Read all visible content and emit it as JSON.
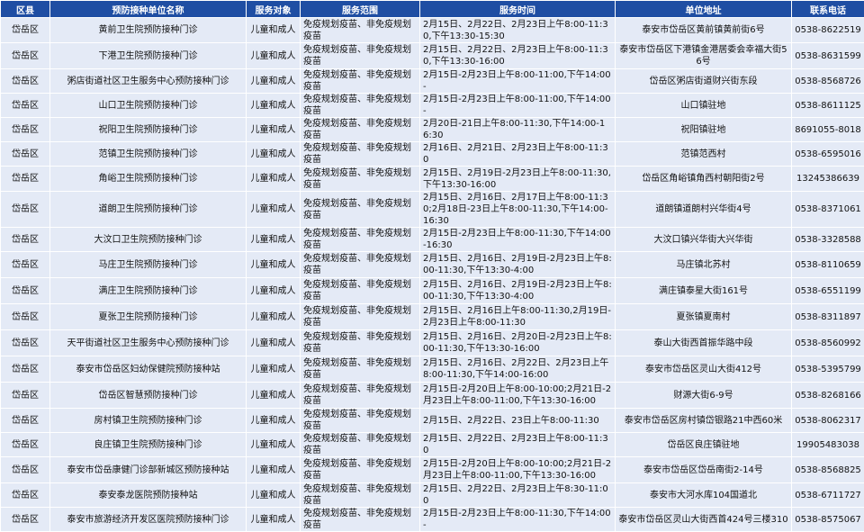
{
  "header": [
    "区县",
    "预防接种单位名称",
    "服务对象",
    "服务范围",
    "服务时间",
    "单位地址",
    "联系电话"
  ],
  "rows": [
    {
      "county": "岱岳区",
      "name": "黄前卫生院预防接种门诊",
      "target": "儿童和成人",
      "scope": "免疫规划疫苗、非免疫规划疫苗",
      "time": "2月15日、2月22日、2月23日上午8:00-11:30,下午13:30-15:30",
      "address": "泰安市岱岳区黄前镇黄前街6号",
      "phone": "0538-8622519"
    },
    {
      "county": "岱岳区",
      "name": "下港卫生院预防接种门诊",
      "target": "儿童和成人",
      "scope": "免疫规划疫苗、非免疫规划疫苗",
      "time": "2月15日、2月22日、2月23日上午8:00-11:30,下午13:30-16:00",
      "address": "泰安市岱岳区下港镇金港居委会幸福大街56号",
      "phone": "0538-8631599"
    },
    {
      "county": "岱岳区",
      "name": "粥店街道社区卫生服务中心预防接种门诊",
      "target": "儿童和成人",
      "scope": "免疫规划疫苗、非免疫规划疫苗",
      "time": "2月15日-2月23日上午8:00-11:00,下午14:00-",
      "address": "岱岳区粥店街道财兴街东段",
      "phone": "0538-8568726"
    },
    {
      "county": "岱岳区",
      "name": "山口卫生院预防接种门诊",
      "target": "儿童和成人",
      "scope": "免疫规划疫苗、非免疫规划疫苗",
      "time": "2月15日-2月23日上午8:00-11:00,下午14:00-",
      "address": "山口镇驻地",
      "phone": "0538-8611125"
    },
    {
      "county": "岱岳区",
      "name": "祝阳卫生院预防接种门诊",
      "target": "儿童和成人",
      "scope": "免疫规划疫苗、非免疫规划疫苗",
      "time": "2月20日-21日上午8:00-11:30,下午14:00-16:30",
      "address": "祝阳镇驻地",
      "phone": "8691055-8018"
    },
    {
      "county": "岱岳区",
      "name": "范镇卫生院预防接种门诊",
      "target": "儿童和成人",
      "scope": "免疫规划疫苗、非免疫规划疫苗",
      "time": "2月16日、2月21日、2月23日上午8:00-11:30",
      "address": "范镇范西村",
      "phone": "0538-6595016"
    },
    {
      "county": "岱岳区",
      "name": "角峪卫生院预防接种门诊",
      "target": "儿童和成人",
      "scope": "免疫规划疫苗、非免疫规划疫苗",
      "time": "2月15日、2月19日-2月23日上午8:00-11:30,下午13:30-16:00",
      "address": "岱岳区角峪镇角西村朝阳街2号",
      "phone": "13245386639"
    },
    {
      "county": "岱岳区",
      "name": "道朗卫生院预防接种门诊",
      "target": "儿童和成人",
      "scope": "免疫规划疫苗、非免疫规划疫苗",
      "time": "2月15日、2月16日、2月17日上午8:00-11:30;2月18日-23日上午8:00-11:30,下午14:00-16:30",
      "address": "道朗镇道朗村兴华街4号",
      "phone": "0538-8371061"
    },
    {
      "county": "岱岳区",
      "name": "大汶口卫生院预防接种门诊",
      "target": "儿童和成人",
      "scope": "免疫规划疫苗、非免疫规划疫苗",
      "time": "2月15日-2月23日上午8:00-11:30,下午14:00-16:30",
      "address": "大汶口镇兴华街大兴华街",
      "phone": "0538-3328588"
    },
    {
      "county": "岱岳区",
      "name": "马庄卫生院预防接种门诊",
      "target": "儿童和成人",
      "scope": "免疫规划疫苗、非免疫规划疫苗",
      "time": "2月15日、2月16日、2月19日-2月23日上午8:00-11:30,下午13:30-4:00",
      "address": "马庄镇北苏村",
      "phone": "0538-8110659"
    },
    {
      "county": "岱岳区",
      "name": "满庄卫生院预防接种门诊",
      "target": "儿童和成人",
      "scope": "免疫规划疫苗、非免疫规划疫苗",
      "time": "2月15日、2月16日、2月19日-2月23日上午8:00-11:30,下午13:30-4:00",
      "address": "满庄镇泰星大街161号",
      "phone": "0538-6551199"
    },
    {
      "county": "岱岳区",
      "name": "夏张卫生院预防接种门诊",
      "target": "儿童和成人",
      "scope": "免疫规划疫苗、非免疫规划疫苗",
      "time": "2月15日、2月16日上午8:00-11:30,2月19日-2月23日上午8:00-11:30",
      "address": "夏张镇夏南村",
      "phone": "0538-8311897"
    },
    {
      "county": "岱岳区",
      "name": "天平街道社区卫生服务中心预防接种门诊",
      "target": "儿童和成人",
      "scope": "免疫规划疫苗、非免疫规划疫苗",
      "time": "2月15日、2月16日、2月20日-2月23日上午8:00-11:30,下午13:30-16:00",
      "address": "泰山大街西首振华路中段",
      "phone": "0538-8560992"
    },
    {
      "county": "岱岳区",
      "name": "泰安市岱岳区妇幼保健院预防接种站",
      "target": "儿童和成人",
      "scope": "免疫规划疫苗、非免疫规划疫苗",
      "time": "2月15日、2月16日、2月22日、2月23日上午8:00-11:30,下午14:00-16:00",
      "address": "泰安市岱岳区灵山大街412号",
      "phone": "0538-5395799"
    },
    {
      "county": "岱岳区",
      "name": "岱岳区智慧预防接种门诊",
      "target": "儿童和成人",
      "scope": "免疫规划疫苗、非免疫规划疫苗",
      "time": "2月15日-2月20日上午8:00-10:00;2月21日-2月23日上午8:00-11:00,下午13:30-16:00",
      "address": "财源大街6-9号",
      "phone": "0538-8268166"
    },
    {
      "county": "岱岳区",
      "name": "房村镇卫生院预防接种门诊",
      "target": "儿童和成人",
      "scope": "免疫规划疫苗、非免疫规划疫苗",
      "time": "2月15日、2月22日、23日上午8:00-11:30",
      "address": "泰安市岱岳区房村镇岱银路21中西60米",
      "phone": "0538-8062317"
    },
    {
      "county": "岱岳区",
      "name": "良庄镇卫生院预防接种门诊",
      "target": "儿童和成人",
      "scope": "免疫规划疫苗、非免疫规划疫苗",
      "time": "2月15日、2月22日、2月23日上午8:00-11:30",
      "address": "岱岳区良庄镇驻地",
      "phone": "19905483038"
    },
    {
      "county": "岱岳区",
      "name": "泰安市岱岳康健门诊部新城区预防接种站",
      "target": "儿童和成人",
      "scope": "免疫规划疫苗、非免疫规划疫苗",
      "time": "2月15日-2月20日上午8:00-10:00;2月21日-2月23日上午8:00-11:00,下午13:30-16:00",
      "address": "泰安市岱岳区岱岳南街2-14号",
      "phone": "0538-8568825"
    },
    {
      "county": "岱岳区",
      "name": "泰安泰龙医院预防接种站",
      "target": "儿童和成人",
      "scope": "免疫规划疫苗、非免疫规划疫苗",
      "time": "2月15日、2月22日、2月23日上午8:30-11:00",
      "address": "泰安市大河水库104国道北",
      "phone": "0538-6711727"
    },
    {
      "county": "岱岳区",
      "name": "泰安市旅游经济开发区医院预防接种门诊",
      "target": "儿童和成人",
      "scope": "免疫规划疫苗、非免疫规划疫苗",
      "time": "2月15日-2月23日上午8:00-11:30,下午14:00-",
      "address": "泰安市岱岳区灵山大街西首424号三楼310",
      "phone": "0538-8575067"
    }
  ]
}
